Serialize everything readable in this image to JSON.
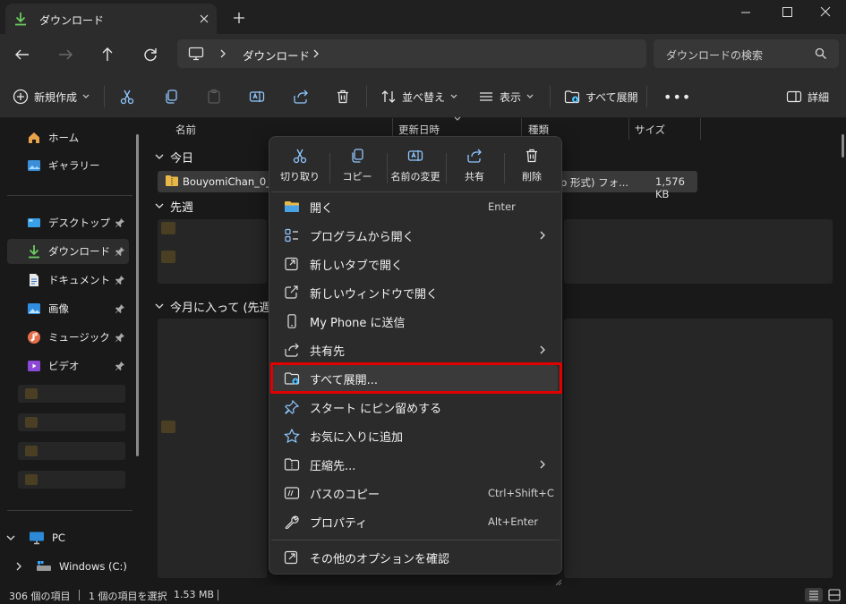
{
  "tab": {
    "title": "ダウンロード"
  },
  "address": {
    "breadcrumb": "ダウンロード",
    "search_placeholder": "ダウンロードの検索"
  },
  "toolbar": {
    "new_label": "新規作成",
    "sort_label": "並べ替え",
    "view_label": "表示",
    "extract_label": "すべて展開",
    "details_label": "詳細"
  },
  "sidebar": {
    "home": "ホーム",
    "gallery": "ギャラリー",
    "desktop": "デスクトップ",
    "downloads": "ダウンロード",
    "documents": "ドキュメント",
    "pictures": "画像",
    "music": "ミュージック",
    "videos": "ビデオ",
    "pc": "PC",
    "windows_drive": "Windows (C:)"
  },
  "columns": {
    "name": "名前",
    "modified": "更新日時",
    "type": "種類",
    "size": "サイズ"
  },
  "groups": {
    "today": "今日",
    "last_week": "先週",
    "earlier_this_month": "今月に入って (先週"
  },
  "file": {
    "name": "BouyomiChan_0_1",
    "type": "p 形式) フォ...",
    "size": "1,576 KB"
  },
  "context_menu": {
    "quick_actions": {
      "cut": "切り取り",
      "copy": "コピー",
      "rename": "名前の変更",
      "share": "共有",
      "delete": "削除"
    },
    "items": {
      "open": "開く",
      "open_shortcut": "Enter",
      "open_with": "プログラムから開く",
      "open_new_tab": "新しいタブで開く",
      "open_new_window": "新しいウィンドウで開く",
      "send_to_phone": "My Phone に送信",
      "share_to": "共有先",
      "extract_all": "すべて展開...",
      "pin_start": "スタート にピン留めする",
      "add_favorites": "お気に入りに追加",
      "compress_to": "圧縮先...",
      "copy_path": "パスのコピー",
      "copy_path_shortcut": "Ctrl+Shift+C",
      "properties": "プロパティ",
      "properties_shortcut": "Alt+Enter",
      "more_options": "その他のオプションを確認"
    }
  },
  "status": {
    "item_count": "306 個の項目",
    "selected": "1 個の項目を選択",
    "selected_size": "1.53 MB"
  },
  "colors": {
    "accent": "#4cc2ff",
    "highlight_box": "#e00000",
    "download_green": "#6ccb5f"
  }
}
